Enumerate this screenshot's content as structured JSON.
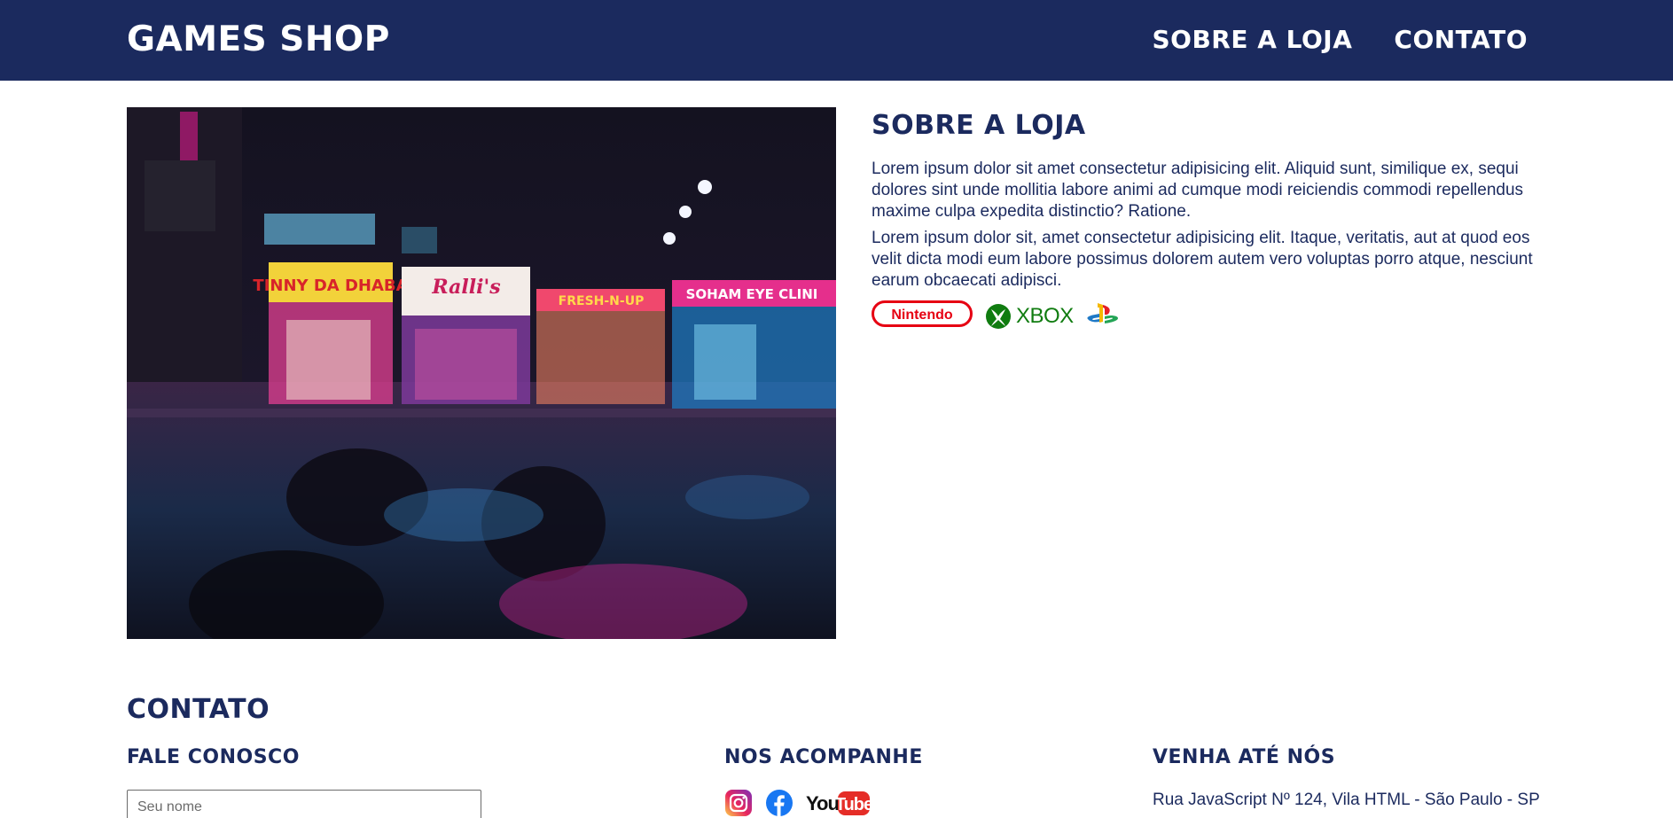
{
  "header": {
    "brand": "GAMES SHOP",
    "nav": [
      {
        "label": "SOBRE A LOJA"
      },
      {
        "label": "CONTATO"
      }
    ]
  },
  "about": {
    "title": "SOBRE A LOJA",
    "paragraphs": [
      "Lorem ipsum dolor sit amet consectetur adipisicing elit. Aliquid sunt, similique ex, sequi dolores sint unde mollitia labore animi ad cumque modi reiciendis commodi repellendus maxime culpa expedita distinctio? Ratione.",
      "Lorem ipsum dolor sit, amet consectetur adipisicing elit. Itaque, veritatis, aut at quod eos velit dicta modi eum labore possimus dolorem autem vero voluptas porro atque, nesciunt earum obcaecati adipisci."
    ],
    "brands": [
      "Nintendo",
      "XBOX",
      "playstation-icon"
    ]
  },
  "photo": {
    "signs": [
      "TINNY DA DHABA",
      "Ralli's",
      "FRESH-N-UP",
      "SOHAM EYE CLINI"
    ]
  },
  "contact": {
    "title": "CONTATO",
    "columns": {
      "form_title": "FALE CONOSCO",
      "social_title": "NOS ACOMPANHE",
      "visit_title": "VENHA ATÉ NÓS"
    },
    "name_placeholder": "Seu nome",
    "social": [
      "instagram-icon",
      "facebook-icon",
      "youtube-icon"
    ],
    "address": "Rua JavaScript Nº 124, Vila HTML - São Paulo - SP"
  },
  "colors": {
    "navy": "#1b2a5e",
    "nintendo_red": "#e60012",
    "xbox_green": "#107c10"
  }
}
